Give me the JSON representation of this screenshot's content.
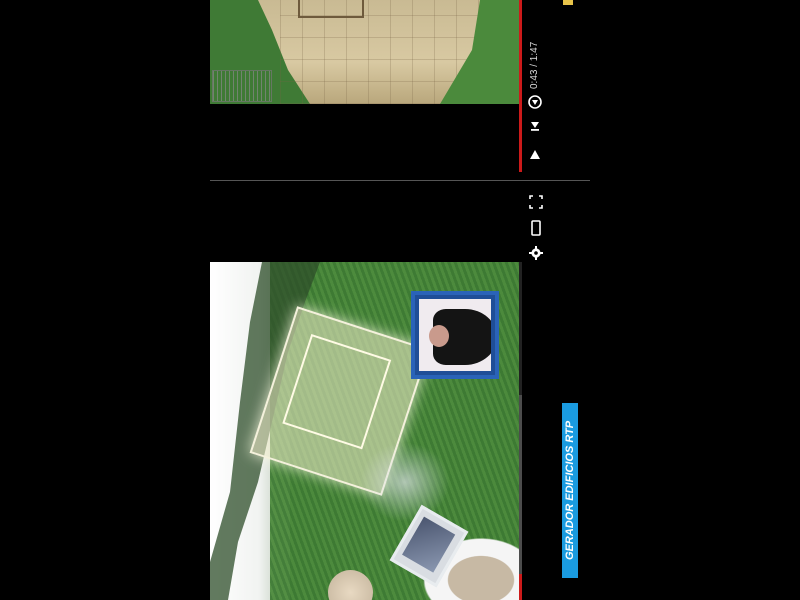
{
  "top_player": {
    "time_display": "0:43 / 1:47",
    "icons": [
      "circle-play-icon",
      "skip-next-icon",
      "play-icon"
    ]
  },
  "bottom_player": {
    "icons": [
      "fullscreen-icon",
      "mobile-icon",
      "settings-gear-icon"
    ],
    "progress_fraction": 0.08,
    "title": "GERADOR EDIFICIOS RTP"
  },
  "colors": {
    "progress_red": "#cc1a1a",
    "title_badge_blue": "#1a9be0",
    "signer_frame_blue": "#2a63b8"
  }
}
